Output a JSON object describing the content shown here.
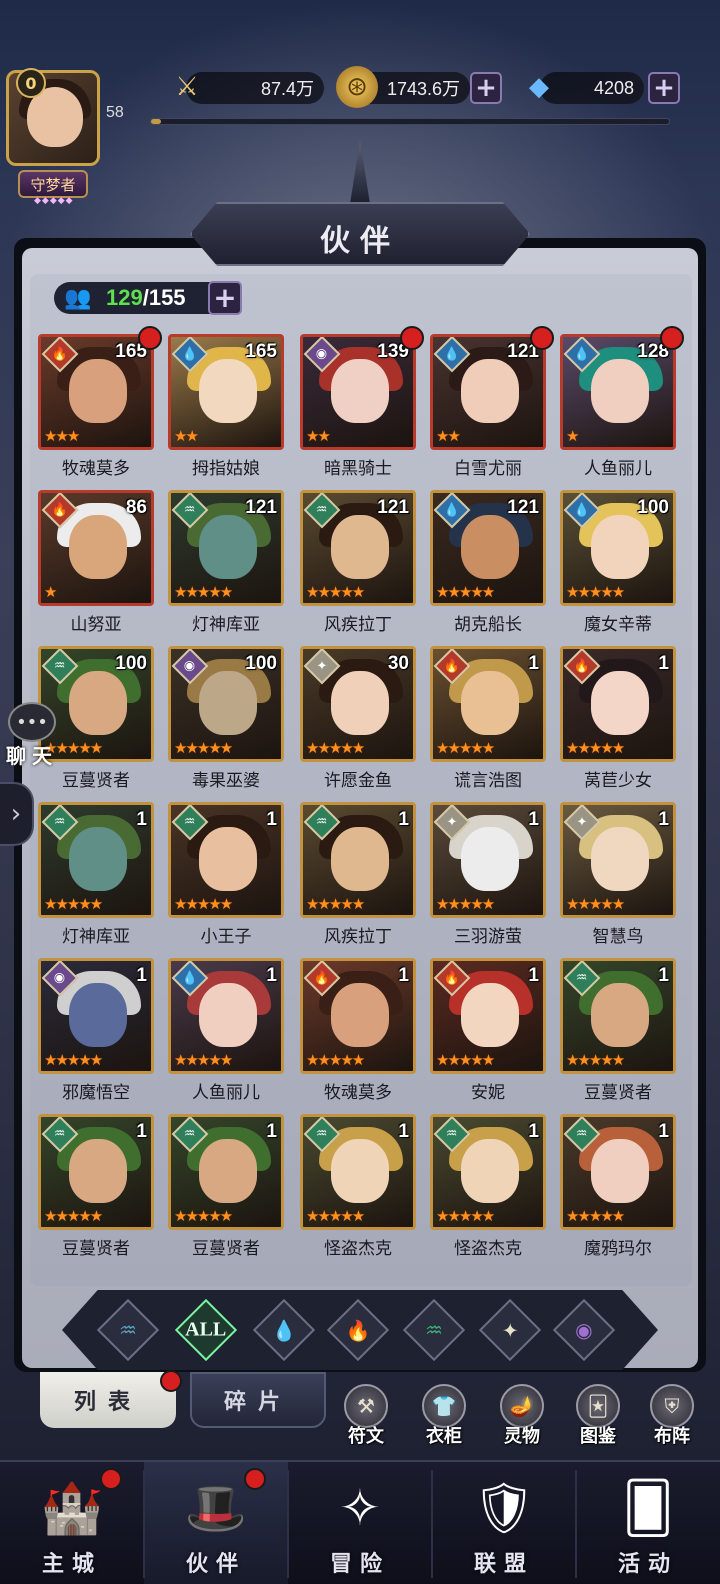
{
  "player": {
    "vip": "0",
    "level": "58",
    "title": "守梦者",
    "title_stars": "◆◆◆◆◆",
    "xp_fraction": 0.02
  },
  "resources": {
    "power": "87.4万",
    "gold": "1743.6万",
    "diamond": "4208"
  },
  "panel": {
    "title": "伙伴",
    "count_current": "129",
    "count_total": "/155"
  },
  "heroes": [
    {
      "name": "牧魂莫多",
      "level": "165",
      "stars": 3,
      "element": "fire",
      "frame": "red",
      "dot": true,
      "palette": [
        "#6b3a2a",
        "#d8a07d",
        "#3a1f16"
      ]
    },
    {
      "name": "拇指姑娘",
      "level": "165",
      "stars": 2,
      "element": "water",
      "frame": "red",
      "dot": false,
      "palette": [
        "#9b7a4a",
        "#f2d8bf",
        "#e0b64a"
      ]
    },
    {
      "name": "暗黑骑士",
      "level": "139",
      "stars": 2,
      "element": "dark",
      "frame": "red",
      "dot": true,
      "palette": [
        "#3a2a3a",
        "#f0d0c4",
        "#a8312a"
      ]
    },
    {
      "name": "白雪尤丽",
      "level": "121",
      "stars": 2,
      "element": "water",
      "frame": "red",
      "dot": true,
      "palette": [
        "#4a3330",
        "#efcdb8",
        "#2b1a16"
      ]
    },
    {
      "name": "人鱼丽儿",
      "level": "128",
      "stars": 1,
      "element": "water",
      "frame": "red",
      "dot": true,
      "palette": [
        "#5a4a6a",
        "#f0cfc0",
        "#1e8e7e"
      ]
    },
    {
      "name": "山努亚",
      "level": "86",
      "stars": 1,
      "element": "fire",
      "frame": "red",
      "dot": false,
      "palette": [
        "#5a3a2a",
        "#d8a67a",
        "#ececec"
      ]
    },
    {
      "name": "灯神库亚",
      "level": "121",
      "stars": 5,
      "element": "wind",
      "frame": "gold",
      "dot": false,
      "palette": [
        "#2e3a2e",
        "#5f8f86",
        "#4a6a34"
      ]
    },
    {
      "name": "风疾拉丁",
      "level": "121",
      "stars": 5,
      "element": "wind",
      "frame": "gold",
      "dot": false,
      "palette": [
        "#5a4a30",
        "#e0b890",
        "#2b1a12"
      ]
    },
    {
      "name": "胡克船长",
      "level": "121",
      "stars": 5,
      "element": "water",
      "frame": "gold",
      "dot": false,
      "palette": [
        "#3a2a20",
        "#c98e62",
        "#24324a"
      ]
    },
    {
      "name": "魔女辛蒂",
      "level": "100",
      "stars": 5,
      "element": "water",
      "frame": "gold",
      "dot": false,
      "palette": [
        "#5a5036",
        "#f2d4bd",
        "#e4c45a"
      ]
    },
    {
      "name": "豆蔓贤者",
      "level": "100",
      "stars": 5,
      "element": "wind",
      "frame": "gold",
      "dot": false,
      "palette": [
        "#34452a",
        "#d8a882",
        "#3f6e2f"
      ]
    },
    {
      "name": "毒果巫婆",
      "level": "100",
      "stars": 5,
      "element": "dark",
      "frame": "gold",
      "dot": false,
      "palette": [
        "#3a3226",
        "#bca888",
        "#9a7a44"
      ]
    },
    {
      "name": "许愿金鱼",
      "level": "30",
      "stars": 5,
      "element": "light",
      "frame": "gold",
      "dot": false,
      "palette": [
        "#4a3a28",
        "#f0d0b8",
        "#2b1a12"
      ]
    },
    {
      "name": "谎言浩图",
      "level": "1",
      "stars": 5,
      "element": "fire",
      "frame": "gold",
      "dot": false,
      "palette": [
        "#6a5030",
        "#e8c094",
        "#c09a4a"
      ]
    },
    {
      "name": "莴苣少女",
      "level": "1",
      "stars": 5,
      "element": "fire",
      "frame": "gold",
      "dot": false,
      "palette": [
        "#3a2a2a",
        "#f4d6c8",
        "#22181a"
      ]
    },
    {
      "name": "灯神库亚",
      "level": "1",
      "stars": 5,
      "element": "wind",
      "frame": "gold",
      "dot": false,
      "palette": [
        "#2e3a2e",
        "#5f8f86",
        "#4a6a34"
      ]
    },
    {
      "name": "小王子",
      "level": "1",
      "stars": 5,
      "element": "wind",
      "frame": "gold",
      "dot": false,
      "palette": [
        "#4a3426",
        "#e8c0a0",
        "#2b1a12"
      ]
    },
    {
      "name": "风疾拉丁",
      "level": "1",
      "stars": 5,
      "element": "wind",
      "frame": "gold",
      "dot": false,
      "palette": [
        "#5a4a30",
        "#e0b890",
        "#2b1a12"
      ]
    },
    {
      "name": "三羽游萤",
      "level": "1",
      "stars": 5,
      "element": "light",
      "frame": "gold",
      "dot": false,
      "palette": [
        "#5a4a3a",
        "#ececec",
        "#d8d4cc"
      ]
    },
    {
      "name": "智慧鸟",
      "level": "1",
      "stars": 5,
      "element": "light",
      "frame": "gold",
      "dot": false,
      "palette": [
        "#6a5a40",
        "#f0d8c0",
        "#d8c080"
      ]
    },
    {
      "name": "邪魔悟空",
      "level": "1",
      "stars": 5,
      "element": "dark",
      "frame": "gold",
      "dot": false,
      "palette": [
        "#2a2a3a",
        "#5a6a9a",
        "#cfcfcf"
      ]
    },
    {
      "name": "人鱼丽儿",
      "level": "1",
      "stars": 5,
      "element": "water",
      "frame": "gold",
      "dot": false,
      "palette": [
        "#4a3a4a",
        "#f0cfc0",
        "#a83a3a"
      ]
    },
    {
      "name": "牧魂莫多",
      "level": "1",
      "stars": 5,
      "element": "fire",
      "frame": "gold",
      "dot": false,
      "palette": [
        "#6b3a2a",
        "#d8a07d",
        "#3a1f16"
      ]
    },
    {
      "name": "安妮",
      "level": "1",
      "stars": 5,
      "element": "fire",
      "frame": "gold",
      "dot": false,
      "palette": [
        "#5a2a20",
        "#f2d6c0",
        "#b8302a"
      ]
    },
    {
      "name": "豆蔓贤者",
      "level": "1",
      "stars": 5,
      "element": "wind",
      "frame": "gold",
      "dot": false,
      "palette": [
        "#34452a",
        "#d8a882",
        "#3f6e2f"
      ]
    },
    {
      "name": "豆蔓贤者",
      "level": "1",
      "stars": 5,
      "element": "wind",
      "frame": "gold",
      "dot": false,
      "palette": [
        "#34452a",
        "#d8a882",
        "#3f6e2f"
      ]
    },
    {
      "name": "豆蔓贤者",
      "level": "1",
      "stars": 5,
      "element": "wind",
      "frame": "gold",
      "dot": false,
      "palette": [
        "#34452a",
        "#d8a882",
        "#3f6e2f"
      ]
    },
    {
      "name": "怪盗杰克",
      "level": "1",
      "stars": 5,
      "element": "wind",
      "frame": "gold",
      "dot": false,
      "palette": [
        "#4a4a30",
        "#f0d4b8",
        "#c8a04a"
      ]
    },
    {
      "name": "怪盗杰克",
      "level": "1",
      "stars": 5,
      "element": "wind",
      "frame": "gold",
      "dot": false,
      "palette": [
        "#4a4a30",
        "#f0d4b8",
        "#c8a04a"
      ]
    },
    {
      "name": "魔鸦玛尔",
      "level": "1",
      "stars": 5,
      "element": "wind",
      "frame": "gold",
      "dot": false,
      "palette": [
        "#4a3a2a",
        "#f0cfc0",
        "#b8603a"
      ]
    }
  ],
  "filters": [
    {
      "key": "wind-alt",
      "icon": "♒",
      "color": "#5aa0c0"
    },
    {
      "key": "all",
      "icon": "ALL",
      "color": "#7cf1a0",
      "active": true
    },
    {
      "key": "water",
      "icon": "💧",
      "color": "#4aa0e0"
    },
    {
      "key": "fire",
      "icon": "🔥",
      "color": "#e05a3a"
    },
    {
      "key": "wind",
      "icon": "♒",
      "color": "#3ab07a"
    },
    {
      "key": "light",
      "icon": "✦",
      "color": "#e8e0c8"
    },
    {
      "key": "dark",
      "icon": "◉",
      "color": "#a070d0"
    }
  ],
  "subtabs": {
    "list": "列表",
    "fragments": "碎片"
  },
  "tools": [
    {
      "label": "符文",
      "icon": "⚒"
    },
    {
      "label": "衣柜",
      "icon": "👕"
    },
    {
      "label": "灵物",
      "icon": "🪔"
    },
    {
      "label": "图鉴",
      "icon": "🃏"
    },
    {
      "label": "布阵",
      "icon": "⛨"
    }
  ],
  "nav": [
    {
      "label": "主城",
      "icon": "🏰",
      "dot": true
    },
    {
      "label": "伙伴",
      "icon": "🎩",
      "dot": true,
      "active": true
    },
    {
      "label": "冒险",
      "icon": "✧",
      "dot": false
    },
    {
      "label": "联盟",
      "icon": "🛡",
      "dot": false
    },
    {
      "label": "活动",
      "icon": "🂠",
      "dot": false
    }
  ],
  "chat": {
    "label": "聊天"
  },
  "element_icons": {
    "fire": "🔥",
    "water": "💧",
    "wind": "♒",
    "light": "✦",
    "dark": "◉"
  },
  "element_colors": {
    "fire": "#b33a2a",
    "water": "#2f6fa8",
    "wind": "#2f7f5a",
    "light": "#9a9484",
    "dark": "#6a4a8a"
  }
}
